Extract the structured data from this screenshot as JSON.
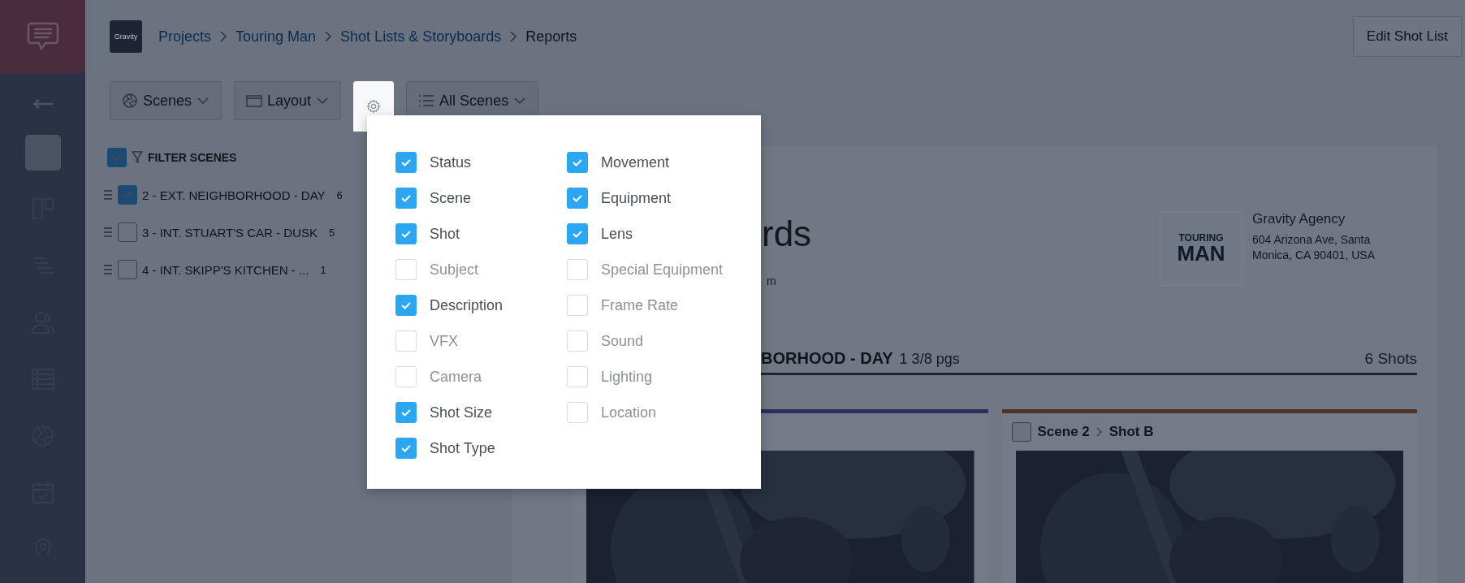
{
  "breadcrumbs": {
    "logo_text": "Gravity",
    "items": [
      {
        "label": "Projects",
        "current": false
      },
      {
        "label": "Touring Man",
        "current": false
      },
      {
        "label": "Shot Lists & Storyboards",
        "current": false
      },
      {
        "label": "Reports",
        "current": true
      }
    ]
  },
  "edit_button": "Edit Shot List",
  "toolbar": [
    {
      "kind": "scenes",
      "label": "Scenes",
      "selected": false
    },
    {
      "kind": "layout",
      "label": "Layout",
      "selected": false
    },
    {
      "kind": "settings",
      "selected": true
    },
    {
      "kind": "list",
      "label": "All Scenes",
      "selected": false
    }
  ],
  "scene_filter": {
    "label": "FILTER SCENES",
    "checked": true,
    "scenes": [
      {
        "label": "2 - EXT. NEIGHBORHOOD - DAY",
        "count": "6",
        "checked": true
      },
      {
        "label": "3 - INT. STUART'S CAR - DUSK",
        "count": "5",
        "checked": false
      },
      {
        "label": "4 - INT. SKIPP'S KITCHEN - ...",
        "count": "1",
        "checked": false
      }
    ]
  },
  "column_menu": {
    "left": [
      {
        "label": "Status",
        "checked": true
      },
      {
        "label": "Scene",
        "checked": true
      },
      {
        "label": "Shot",
        "checked": true
      },
      {
        "label": "Subject",
        "checked": false
      },
      {
        "label": "Description",
        "checked": true
      },
      {
        "label": "VFX",
        "checked": false
      },
      {
        "label": "Camera",
        "checked": false
      },
      {
        "label": "Shot Size",
        "checked": true
      },
      {
        "label": "Shot Type",
        "checked": true
      }
    ],
    "right": [
      {
        "label": "Movement",
        "checked": true
      },
      {
        "label": "Equipment",
        "checked": true
      },
      {
        "label": "Lens",
        "checked": true
      },
      {
        "label": "Special Equipment",
        "checked": false
      },
      {
        "label": "Frame Rate",
        "checked": false
      },
      {
        "label": "Sound",
        "checked": false
      },
      {
        "label": "Lighting",
        "checked": false
      },
      {
        "label": "Location",
        "checked": false
      }
    ]
  },
  "report": {
    "title": "rds",
    "subtitle": "m",
    "logo": {
      "line_1": "TOURING",
      "line_2": "MAN"
    },
    "company": {
      "name": "Gravity Agency",
      "address_lines": [
        "604 Arizona Ave, Santa",
        "Monica, CA 90401, USA"
      ]
    },
    "section": {
      "heading": "BORHOOD - DAY",
      "pages": "1 3/8 pgs",
      "shots": "6 Shots"
    },
    "cards": [
      {
        "color": "#2c2f5c"
      },
      {
        "color": "#4d3428",
        "checked": false,
        "scene": "Scene 2",
        "shot": "Shot B"
      }
    ]
  }
}
